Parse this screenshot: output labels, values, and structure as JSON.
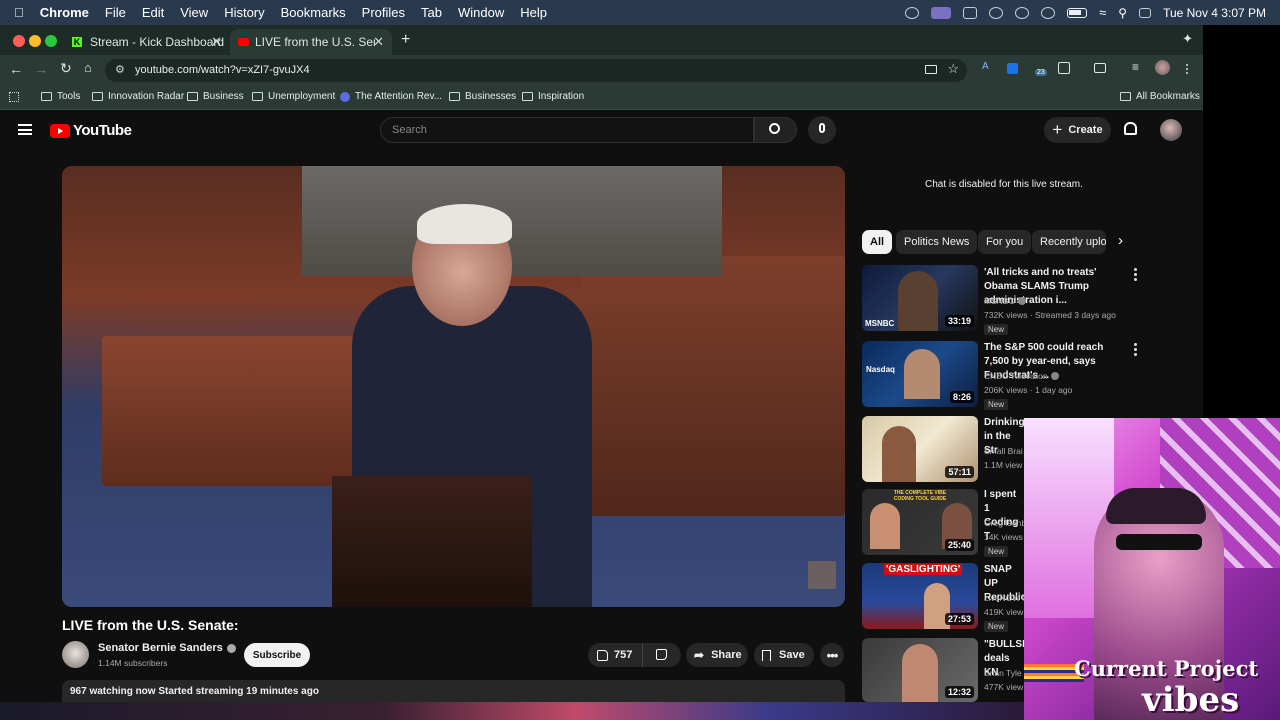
{
  "menubar": {
    "app": "Chrome",
    "items": [
      "File",
      "Edit",
      "View",
      "History",
      "Bookmarks",
      "Profiles",
      "Tab",
      "Window",
      "Help"
    ],
    "clock": "Tue Nov 4  3:07 PM"
  },
  "tabs": [
    {
      "title": "Stream - Kick Dashboard"
    },
    {
      "title": "LIVE from the U.S. Senate: - Y"
    }
  ],
  "address": {
    "url": "youtube.com/watch?v=xZI7-gvuJX4"
  },
  "extension_badge": "23",
  "bookmarks": [
    "Tools",
    "Innovation Radar",
    "Business",
    "Unemployment",
    "The Attention Rev...",
    "Businesses",
    "Inspiration"
  ],
  "bookmarks_all": "All Bookmarks",
  "yt": {
    "logo_text": "YouTube",
    "search_placeholder": "Search",
    "create_label": "Create",
    "chat_disabled": "Chat is disabled for this live stream.",
    "chips": [
      "All",
      "Politics News",
      "For you",
      "Recently uploa"
    ],
    "video_title": "LIVE from the U.S. Senate:",
    "channel_name": "Senator Bernie Sanders",
    "subscribers": "1.14M subscribers",
    "subscribe_label": "Subscribe",
    "likes": "757",
    "share_label": "Share",
    "save_label": "Save",
    "watching": "967 watching now  Started streaming 19 minutes ago",
    "recommendations": [
      {
        "title": "'All tricks and no treats' Obama SLAMS Trump administration i...",
        "channel": "MSNBC",
        "meta": "732K views · Streamed 3 days ago",
        "badge": "New",
        "duration": "33:19",
        "thumb_label": "MSNBC"
      },
      {
        "title": "The S&P 500 could reach 7,500 by year-end, says Fundstrat's ...",
        "channel": "CNBC Television",
        "meta": "206K views · 1 day ago",
        "badge": "New",
        "duration": "8:26",
        "thumb_label": "Nasdaq"
      },
      {
        "title": "Drinking in the Str",
        "channel": "Small Brai",
        "meta": "1.1M view",
        "badge": "",
        "duration": "57:11",
        "thumb_label": ""
      },
      {
        "title": "I spent 1 Coding T",
        "channel": "Greg Isenb",
        "meta": "14K views",
        "badge": "New",
        "duration": "25:40",
        "thumb_label": "THE COMPLETE VIBE CODING TOOL GUIDE"
      },
      {
        "title": "SNAP UP Republica",
        "channel": "LiveNOW f",
        "meta": "419K view",
        "badge": "New",
        "duration": "27:53",
        "thumb_label": "'GASLIGHTING'"
      },
      {
        "title": "\"BULLSH deals KN",
        "channel": "Brian Tyle",
        "meta": "477K view",
        "badge": "New",
        "duration": "12:32",
        "thumb_label": ""
      }
    ]
  },
  "overlay": {
    "line1": "Current Project",
    "line2": "vibes"
  },
  "colors": {
    "menubar": "#2a3a4e",
    "chrome_frame": "#1f2b27",
    "youtube_bg": "#0f0f0f",
    "youtube_red": "#ff0000",
    "overlay_pink": "#d24bd0"
  }
}
